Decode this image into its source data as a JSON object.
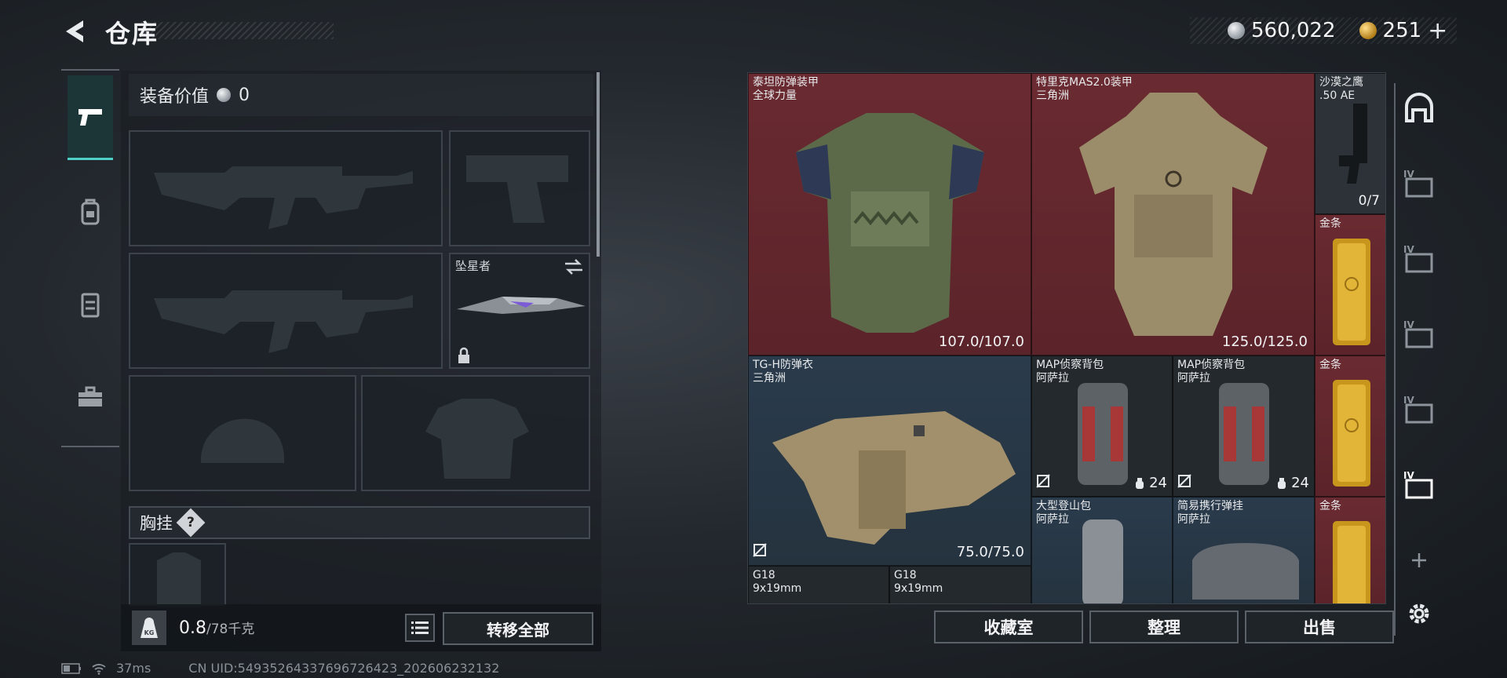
{
  "header": {
    "title": "仓库",
    "silver_amount": "560,022",
    "gold_amount": "251",
    "add_symbol": "+"
  },
  "left_rail": {
    "tabs": [
      "pistol-icon",
      "backpack-icon",
      "vest-icon",
      "toolbox-icon"
    ]
  },
  "equipment": {
    "value_label": "装备价值",
    "value": "0",
    "melee_name": "坠星者",
    "chest_label": "胸挂",
    "chest_help": "?",
    "weight_current": "0.8",
    "weight_max": "/78千克",
    "transfer_all": "转移全部"
  },
  "storage": {
    "items": [
      {
        "name": "泰坦防弹装甲",
        "sub": "全球力量",
        "value": "107.0/107.0",
        "color": "#6a2a31"
      },
      {
        "name": "特里克MAS2.0装甲",
        "sub": "三角洲",
        "value": "125.0/125.0",
        "color": "#6a2a31"
      },
      {
        "name": "沙漠之鹰",
        "sub": ".50 AE",
        "value": "0/7",
        "color": "#2c3237"
      },
      {
        "name": "金条",
        "sub": "",
        "value": "",
        "color": "#6a2a31"
      },
      {
        "name": "TG-H防弹衣",
        "sub": "三角洲",
        "value": "75.0/75.0",
        "color": "#2a3b4c"
      },
      {
        "name": "MAP侦察背包",
        "sub": "阿萨拉",
        "value": "24",
        "color": "#24292e"
      },
      {
        "name": "MAP侦察背包",
        "sub": "阿萨拉",
        "value": "24",
        "color": "#24292e"
      },
      {
        "name": "金条",
        "sub": "",
        "value": "",
        "color": "#6a2a31"
      },
      {
        "name": "大型登山包",
        "sub": "阿萨拉",
        "value": "",
        "color": "#2a3b4c"
      },
      {
        "name": "简易携行弹挂",
        "sub": "阿萨拉",
        "value": "",
        "color": "#2a3b4c"
      },
      {
        "name": "金条",
        "sub": "",
        "value": "",
        "color": "#6a2a31"
      },
      {
        "name": "G18",
        "sub": "9x19mm",
        "value": "",
        "color": "#24292e"
      },
      {
        "name": "G18",
        "sub": "9x19mm",
        "value": "",
        "color": "#24292e"
      }
    ]
  },
  "bottom_buttons": {
    "collection": "收藏室",
    "organize": "整理",
    "sell": "出售"
  },
  "status": {
    "ping": "37ms",
    "uid": "CN UID:54935264337696726423_202606232132"
  }
}
